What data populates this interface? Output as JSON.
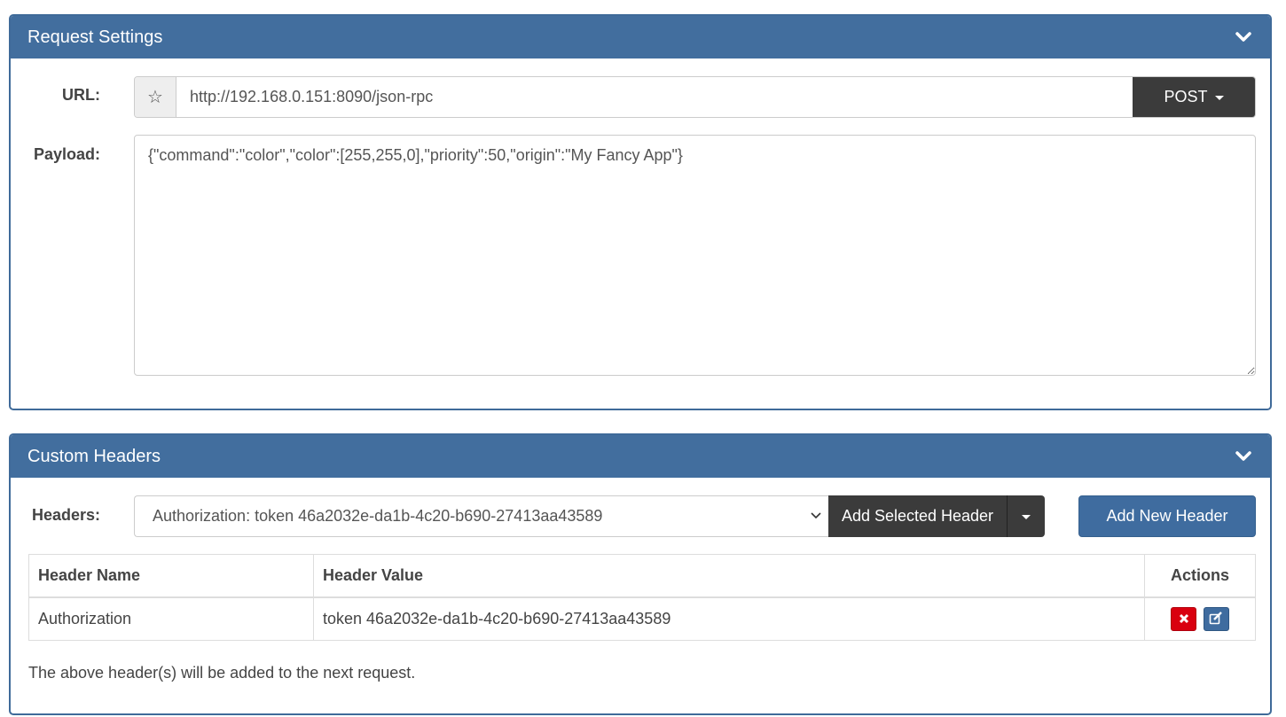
{
  "request_settings": {
    "title": "Request Settings",
    "url_label": "URL:",
    "url_value": "http://192.168.0.151:8090/json-rpc",
    "favorite_icon": "star-outline-icon",
    "method": "POST",
    "payload_label": "Payload:",
    "payload_value": "{\"command\":\"color\",\"color\":[255,255,0],\"priority\":50,\"origin\":\"My Fancy App\"}"
  },
  "custom_headers": {
    "title": "Custom Headers",
    "headers_label": "Headers:",
    "selected_header": "Authorization: token 46a2032e-da1b-4c20-b690-27413aa43589",
    "add_selected_label": "Add Selected Header",
    "add_new_label": "Add New Header",
    "table": {
      "columns": [
        "Header Name",
        "Header Value",
        "Actions"
      ],
      "rows": [
        {
          "name": "Authorization",
          "value": "token 46a2032e-da1b-4c20-b690-27413aa43589"
        }
      ]
    },
    "note": "The above header(s) will be added to the next request."
  },
  "colors": {
    "panel_header": "#426e9e",
    "dark_button": "#3b3b3b",
    "primary_button": "#3f6c9f",
    "delete_button": "#d9000f"
  }
}
